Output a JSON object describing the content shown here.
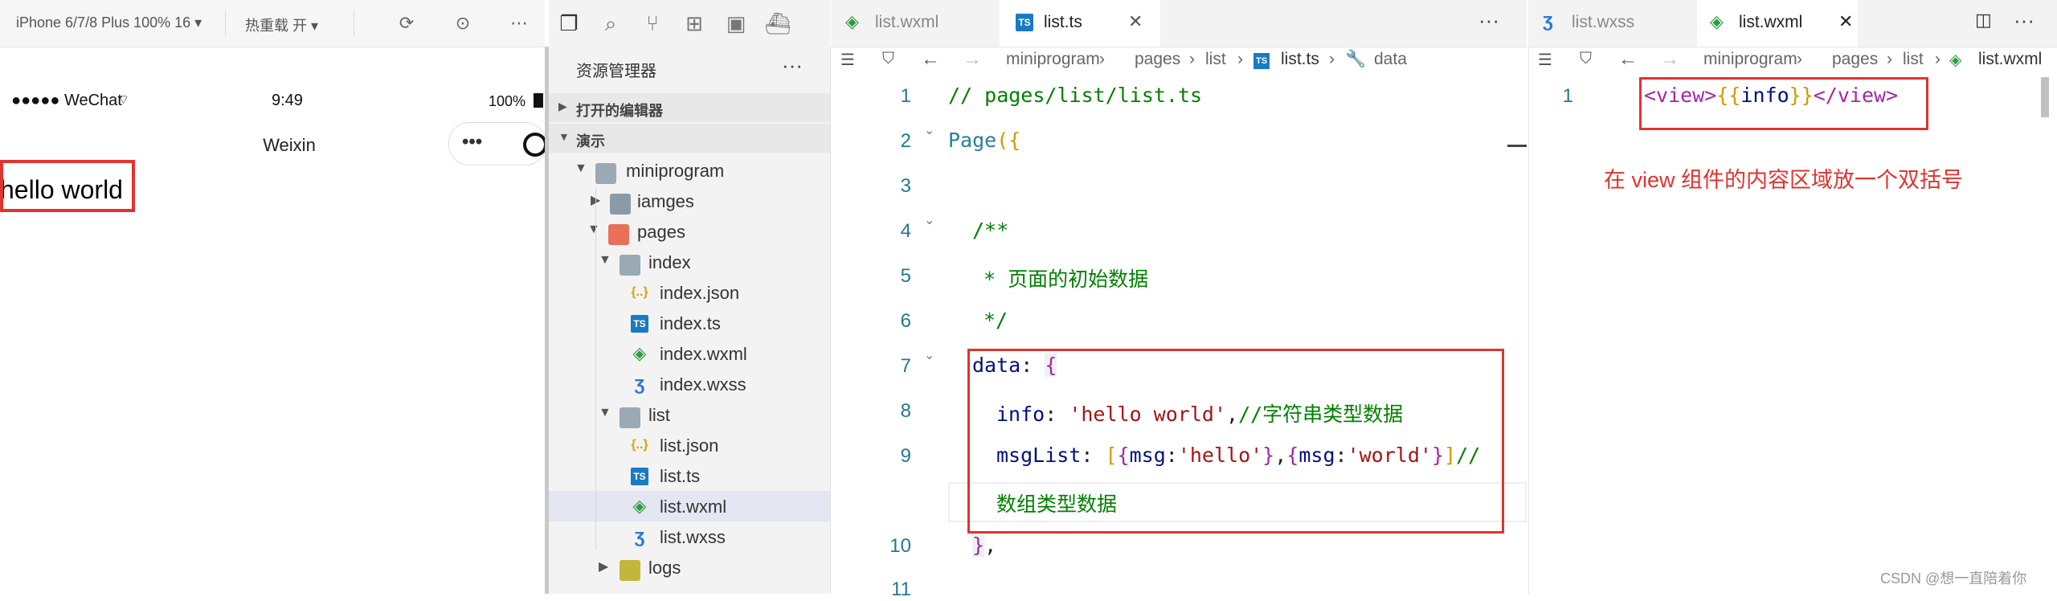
{
  "simulator": {
    "device_label": "iPhone 6/7/8 Plus 100% 16 ▾",
    "hot_reload_label": "热重载 开 ▾",
    "status_signal": "●●●●● WeChat",
    "status_time": "9:49",
    "status_battery": "100%",
    "nav_title": "Weixin",
    "capsule_dots": "•••",
    "content_text": "hello world"
  },
  "explorer": {
    "title": "资源管理器",
    "more": "···",
    "section_open_editors": "打开的编辑器",
    "section_project": "演示",
    "tree": [
      {
        "label": "miniprogram"
      },
      {
        "label": "iamges"
      },
      {
        "label": "pages"
      },
      {
        "label": "index"
      },
      {
        "label": "index.json"
      },
      {
        "label": "index.ts"
      },
      {
        "label": "index.wxml"
      },
      {
        "label": "index.wxss"
      },
      {
        "label": "list"
      },
      {
        "label": "list.json"
      },
      {
        "label": "list.ts"
      },
      {
        "label": "list.wxml"
      },
      {
        "label": "list.wxss"
      },
      {
        "label": "logs"
      }
    ],
    "icons": {
      "json": "{..}",
      "ts": "TS",
      "wxml": "◈",
      "wxss": "ʒ"
    }
  },
  "editor1": {
    "tabs": [
      {
        "label": "list.wxml"
      },
      {
        "label": "list.ts"
      }
    ],
    "more": "···",
    "breadcrumb": [
      "miniprogram",
      "pages",
      "list",
      "list.ts",
      "data"
    ],
    "line_numbers": [
      "1",
      "2",
      "3",
      "4",
      "5",
      "6",
      "7",
      "8",
      "9",
      "10",
      "11"
    ],
    "lines": {
      "l1": "// pages/list/list.ts",
      "l2a": "Page",
      "l2b": "({",
      "l4": "/**",
      "l5": "* 页面的初始数据",
      "l6": "*/",
      "l7a": "data",
      "l7b": ": ",
      "l7c": "{",
      "l8a": "info",
      "l8b": ": ",
      "l8c": "'hello world'",
      "l8d": ",",
      "l8e": "//字符串类型数据",
      "l9a": "msgList",
      "l9b": ": ",
      "l9c": "[",
      "l9d": "{",
      "l9e": "msg",
      "l9f": ":",
      "l9g": "'hello'",
      "l9h": "}",
      "l9i": ",",
      "l9j": "{",
      "l9k": "msg",
      "l9l": ":",
      "l9m": "'world'",
      "l9n": "}",
      "l9o": "]",
      "l9p": "//",
      "l9wrap": "数组类型数据",
      "l10a": "}",
      "l10b": ","
    }
  },
  "editor2": {
    "tabs": [
      {
        "label": "list.wxss"
      },
      {
        "label": "list.wxml"
      }
    ],
    "more": "···",
    "breadcrumb": [
      "miniprogram",
      "pages",
      "list",
      "list.wxml"
    ],
    "line_numbers": [
      "1"
    ],
    "code": {
      "open": "<view>",
      "mustache_open": "{{",
      "var": "info",
      "mustache_close": "}}",
      "close": "</view>"
    },
    "annotation": "在 view 组件的内容区域放一个双括号"
  },
  "watermark": "CSDN @想一直陪着你",
  "colors": {
    "annotation_red": "#e0342f",
    "comment_green": "#008000",
    "string_red": "#a31515"
  }
}
